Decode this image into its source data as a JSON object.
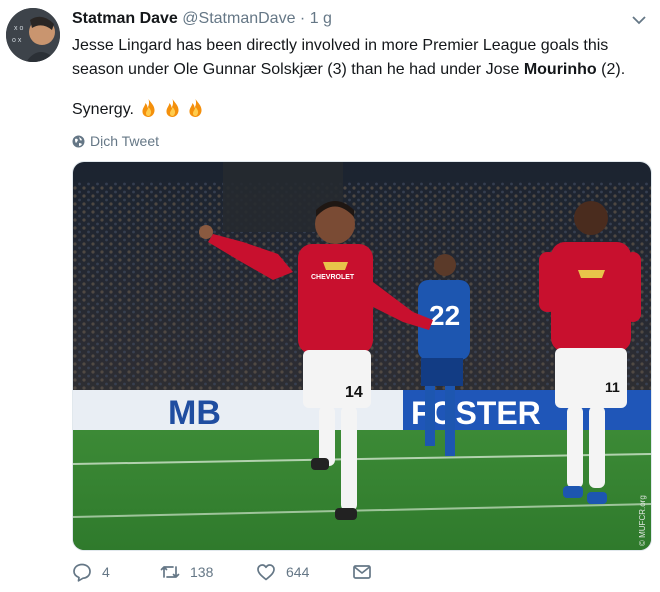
{
  "tweet": {
    "author_name": "Statman Dave",
    "handle": "@StatmanDave",
    "separator": "·",
    "time": "1 g",
    "text_part1": "Jesse Lingard has been directly involved in more Premier League goals this season under Ole Gunnar Solskjær (3) than he had under Jose ",
    "text_bold": "Mourinho",
    "text_part2": " (2).",
    "synergy": "Synergy.",
    "translate_label": "Dịch Tweet"
  },
  "photo": {
    "board_left": "MB",
    "board_right": "FOSTER",
    "shirt_number_main": "14",
    "shirt_number_opponent": "22",
    "shirt_number_right": "11",
    "watermark": "© MUFCR.org",
    "sponsor": "CHEVROLET"
  },
  "actions": {
    "reply_count": "4",
    "retweet_count": "138",
    "like_count": "644"
  },
  "icons": {
    "reply": "reply-icon",
    "retweet": "retweet-icon",
    "like": "heart-icon",
    "dm": "envelope-icon",
    "globe": "globe-icon",
    "caret": "chevron-down-icon",
    "fire": "fire-emoji"
  },
  "colors": {
    "text": "#14171a",
    "muted": "#657786",
    "jersey_red": "#c8102e",
    "pitch_green": "#3f8f3a",
    "opponent_blue": "#1d56b0"
  }
}
